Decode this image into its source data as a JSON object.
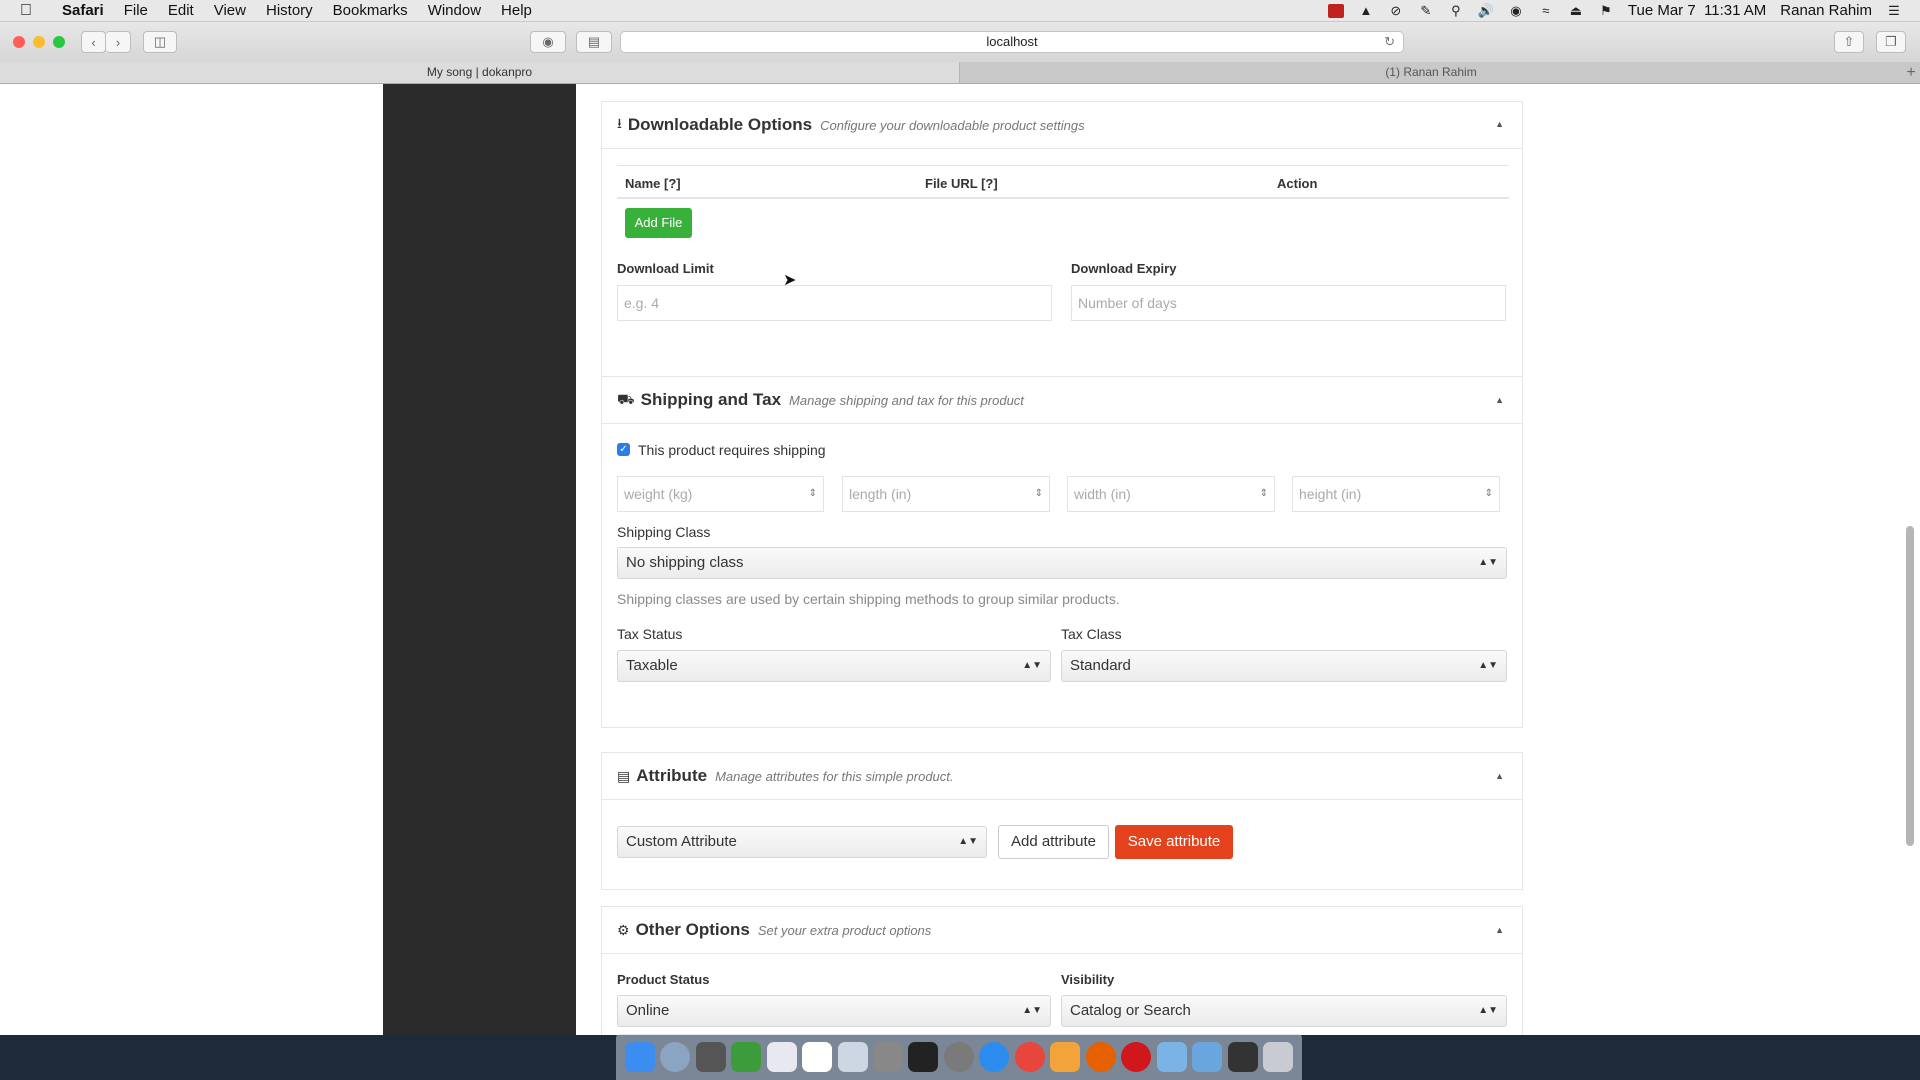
{
  "menubar": {
    "app_name": "Safari",
    "menus": [
      "File",
      "Edit",
      "View",
      "History",
      "Bookmarks",
      "Window",
      "Help"
    ],
    "clock": "Tue Mar 7  11:31 AM",
    "user": "Ranan Rahim"
  },
  "browser": {
    "address": "localhost",
    "tabs": [
      "My song | dokanpro",
      "(1) Ranan Rahim"
    ]
  },
  "downloadable": {
    "title": "Downloadable Options",
    "subtitle": "Configure your downloadable product settings",
    "columns": [
      "Name [?]",
      "File URL [?]",
      "Action"
    ],
    "add_file_label": "Add File",
    "download_limit_label": "Download Limit",
    "download_limit_placeholder": "e.g. 4",
    "download_expiry_label": "Download Expiry",
    "download_expiry_placeholder": "Number of days"
  },
  "shipping": {
    "title": "Shipping and Tax",
    "subtitle": "Manage shipping and tax for this product",
    "requires_shipping_label": "This product requires shipping",
    "requires_shipping_checked": true,
    "weight_placeholder": "weight (kg)",
    "length_placeholder": "length (in)",
    "width_placeholder": "width (in)",
    "height_placeholder": "height (in)",
    "shipping_class_label": "Shipping Class",
    "shipping_class_value": "No shipping class",
    "shipping_class_help": "Shipping classes are used by certain shipping methods to group similar products.",
    "tax_status_label": "Tax Status",
    "tax_status_value": "Taxable",
    "tax_class_label": "Tax Class",
    "tax_class_value": "Standard"
  },
  "attribute": {
    "title": "Attribute",
    "subtitle": "Manage attributes for this simple product.",
    "select_value": "Custom Attribute",
    "add_label": "Add attribute",
    "save_label": "Save attribute"
  },
  "other": {
    "title": "Other Options",
    "subtitle": "Set your extra product options",
    "product_status_label": "Product Status",
    "product_status_value": "Online",
    "visibility_label": "Visibility",
    "visibility_value": "Catalog or Search"
  }
}
